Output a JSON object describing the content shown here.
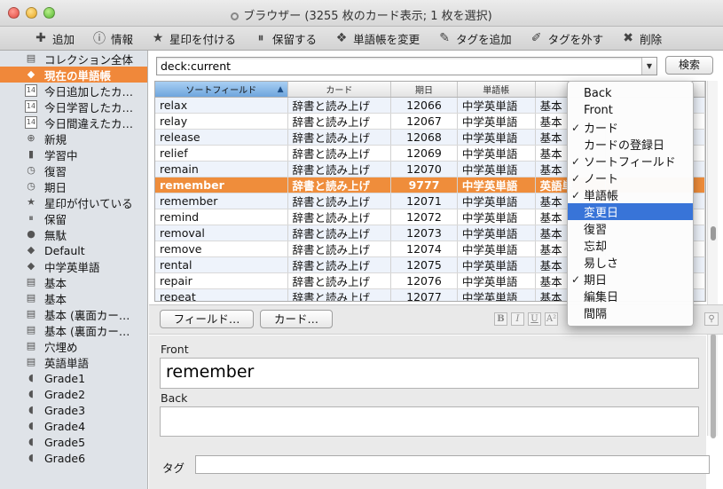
{
  "window": {
    "title": "ブラウザー (3255 枚のカード表示; 1 枚を選択)"
  },
  "toolbar": [
    {
      "icon": "plus-icon",
      "glyph": "✚",
      "label": "追加"
    },
    {
      "icon": "info-icon",
      "glyph": "ⓘ",
      "label": "情報"
    },
    {
      "icon": "star-icon",
      "glyph": "★",
      "label": "星印を付ける"
    },
    {
      "icon": "pause-icon",
      "glyph": "⏸",
      "label": "保留する"
    },
    {
      "icon": "deck-icon",
      "glyph": "❖",
      "label": "単語帳を変更"
    },
    {
      "icon": "tag-add-icon",
      "glyph": "✎",
      "label": "タグを追加"
    },
    {
      "icon": "tag-remove-icon",
      "glyph": "✐",
      "label": "タグを外す"
    },
    {
      "icon": "delete-icon",
      "glyph": "✖",
      "label": "削除"
    }
  ],
  "sidebar": [
    {
      "icon": "collection-icon",
      "glyph": "▤",
      "label": "コレクション全体",
      "selected": false
    },
    {
      "icon": "deck-icon",
      "glyph": "◆",
      "label": "現在の単語帳",
      "selected": true
    },
    {
      "icon": "calendar-icon",
      "glyph": "14",
      "label": "今日追加したカ…",
      "selected": false
    },
    {
      "icon": "calendar-icon",
      "glyph": "14",
      "label": "今日学習したカ…",
      "selected": false
    },
    {
      "icon": "calendar-icon",
      "glyph": "14",
      "label": "今日間違えたカ…",
      "selected": false
    },
    {
      "icon": "new-icon",
      "glyph": "⊕",
      "label": "新規",
      "selected": false
    },
    {
      "icon": "learning-icon",
      "glyph": "▮",
      "label": "学習中",
      "selected": false
    },
    {
      "icon": "review-icon",
      "glyph": "◷",
      "label": "復習",
      "selected": false
    },
    {
      "icon": "due-icon",
      "glyph": "◷",
      "label": "期日",
      "selected": false
    },
    {
      "icon": "star-icon",
      "glyph": "★",
      "label": "星印が付いている",
      "selected": false
    },
    {
      "icon": "suspended-icon",
      "glyph": "⏸",
      "label": "保留",
      "selected": false
    },
    {
      "icon": "buried-icon",
      "glyph": "●",
      "label": "無駄",
      "selected": false
    },
    {
      "icon": "deck-icon",
      "glyph": "◆",
      "label": "Default",
      "selected": false
    },
    {
      "icon": "deck-icon",
      "glyph": "◆",
      "label": "中学英単語",
      "selected": false
    },
    {
      "icon": "notetype-icon",
      "glyph": "▤",
      "label": "基本",
      "selected": false
    },
    {
      "icon": "notetype-icon",
      "glyph": "▤",
      "label": "基本",
      "selected": false
    },
    {
      "icon": "notetype-icon",
      "glyph": "▤",
      "label": "基本 (裏面カー…",
      "selected": false
    },
    {
      "icon": "notetype-icon",
      "glyph": "▤",
      "label": "基本 (裏面カー…",
      "selected": false
    },
    {
      "icon": "notetype-icon",
      "glyph": "▤",
      "label": "穴埋め",
      "selected": false
    },
    {
      "icon": "notetype-icon",
      "glyph": "▤",
      "label": "英語単語",
      "selected": false
    },
    {
      "icon": "tag-icon",
      "glyph": "◖",
      "label": "Grade1",
      "selected": false
    },
    {
      "icon": "tag-icon",
      "glyph": "◖",
      "label": "Grade2",
      "selected": false
    },
    {
      "icon": "tag-icon",
      "glyph": "◖",
      "label": "Grade3",
      "selected": false
    },
    {
      "icon": "tag-icon",
      "glyph": "◖",
      "label": "Grade4",
      "selected": false
    },
    {
      "icon": "tag-icon",
      "glyph": "◖",
      "label": "Grade5",
      "selected": false
    },
    {
      "icon": "tag-icon",
      "glyph": "◖",
      "label": "Grade6",
      "selected": false
    }
  ],
  "search": {
    "value": "deck:current",
    "button_label": "検索"
  },
  "table": {
    "columns": [
      "ソートフィールド",
      "カード",
      "期日",
      "単語帳",
      "",
      ""
    ],
    "rows": [
      [
        "relax",
        "辞書と読み上げ",
        "12066",
        "中学英単語",
        "基本",
        ""
      ],
      [
        "relay",
        "辞書と読み上げ",
        "12067",
        "中学英単語",
        "基本",
        ""
      ],
      [
        "release",
        "辞書と読み上げ",
        "12068",
        "中学英単語",
        "基本",
        ""
      ],
      [
        "relief",
        "辞書と読み上げ",
        "12069",
        "中学英単語",
        "基本",
        ""
      ],
      [
        "remain",
        "辞書と読み上げ",
        "12070",
        "中学英単語",
        "基本",
        ""
      ],
      [
        "remember",
        "辞書と読み上げ",
        "9777",
        "中学英単語",
        "英語単",
        ""
      ],
      [
        "remember",
        "辞書と読み上げ",
        "12071",
        "中学英単語",
        "基本",
        ""
      ],
      [
        "remind",
        "辞書と読み上げ",
        "12072",
        "中学英単語",
        "基本",
        ""
      ],
      [
        "removal",
        "辞書と読み上げ",
        "12073",
        "中学英単語",
        "基本",
        ""
      ],
      [
        "remove",
        "辞書と読み上げ",
        "12074",
        "中学英単語",
        "基本",
        ""
      ],
      [
        "rental",
        "辞書と読み上げ",
        "12075",
        "中学英単語",
        "基本",
        ""
      ],
      [
        "repair",
        "辞書と読み上げ",
        "12076",
        "中学英単語",
        "基本",
        ""
      ],
      [
        "repeat",
        "辞書と読み上げ",
        "12077",
        "中学英単語",
        "基本",
        ""
      ]
    ],
    "selected_index": 5
  },
  "editor": {
    "fields_button": "フィールド…",
    "cards_button": "カード…",
    "format_buttons": [
      "B",
      "I",
      "U",
      "A²",
      "A"
    ],
    "front_label": "Front",
    "front_value": "remember",
    "back_label": "Back",
    "back_value": "",
    "tag_label": "タグ",
    "tag_value": ""
  },
  "column_menu": [
    {
      "label": "Back",
      "checked": false
    },
    {
      "label": "Front",
      "checked": false
    },
    {
      "label": "カード",
      "checked": true
    },
    {
      "label": "カードの登録日",
      "checked": false
    },
    {
      "label": "ソートフィールド",
      "checked": true
    },
    {
      "label": "ノート",
      "checked": true
    },
    {
      "label": "単語帳",
      "checked": true
    },
    {
      "label": "変更日",
      "checked": false,
      "highlighted": true
    },
    {
      "label": "復習",
      "checked": false
    },
    {
      "label": "忘却",
      "checked": false
    },
    {
      "label": "易しさ",
      "checked": false
    },
    {
      "label": "期日",
      "checked": true
    },
    {
      "label": "編集日",
      "checked": false
    },
    {
      "label": "間隔",
      "checked": false
    }
  ],
  "colors": {
    "selection": "#ef8d3b",
    "menu_highlight": "#3874d8",
    "sorted_header": "#8dbbe8"
  }
}
